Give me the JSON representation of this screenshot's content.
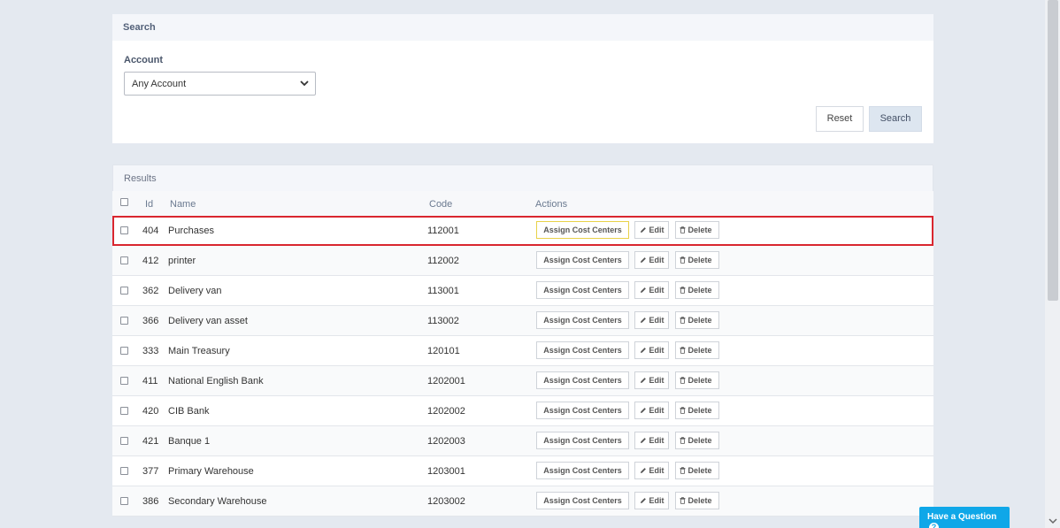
{
  "search": {
    "title": "Search",
    "account_label": "Account",
    "account_selected": "Any Account",
    "reset_label": "Reset",
    "search_label": "Search"
  },
  "results": {
    "title": "Results",
    "columns": {
      "id": "Id",
      "name": "Name",
      "code": "Code",
      "actions": "Actions"
    },
    "action_labels": {
      "assign": "Assign Cost Centers",
      "edit": "Edit",
      "delete": "Delete"
    },
    "rows": [
      {
        "id": "404",
        "name": "Purchases",
        "code": "112001"
      },
      {
        "id": "412",
        "name": "printer",
        "code": "112002"
      },
      {
        "id": "362",
        "name": "Delivery van",
        "code": "113001"
      },
      {
        "id": "366",
        "name": "Delivery van asset",
        "code": "113002"
      },
      {
        "id": "333",
        "name": "Main Treasury",
        "code": "120101"
      },
      {
        "id": "411",
        "name": "National English Bank",
        "code": "1202001"
      },
      {
        "id": "420",
        "name": "CIB Bank",
        "code": "1202002"
      },
      {
        "id": "421",
        "name": "Banque  1",
        "code": "1202003"
      },
      {
        "id": "377",
        "name": "Primary Warehouse",
        "code": "1203001"
      },
      {
        "id": "386",
        "name": "Secondary Warehouse",
        "code": "1203002"
      }
    ]
  },
  "help": {
    "label": "Have a Question"
  },
  "colors": {
    "highlight": "#d9262f",
    "help": "#0fa7e8",
    "background": "#e4e9f0"
  }
}
